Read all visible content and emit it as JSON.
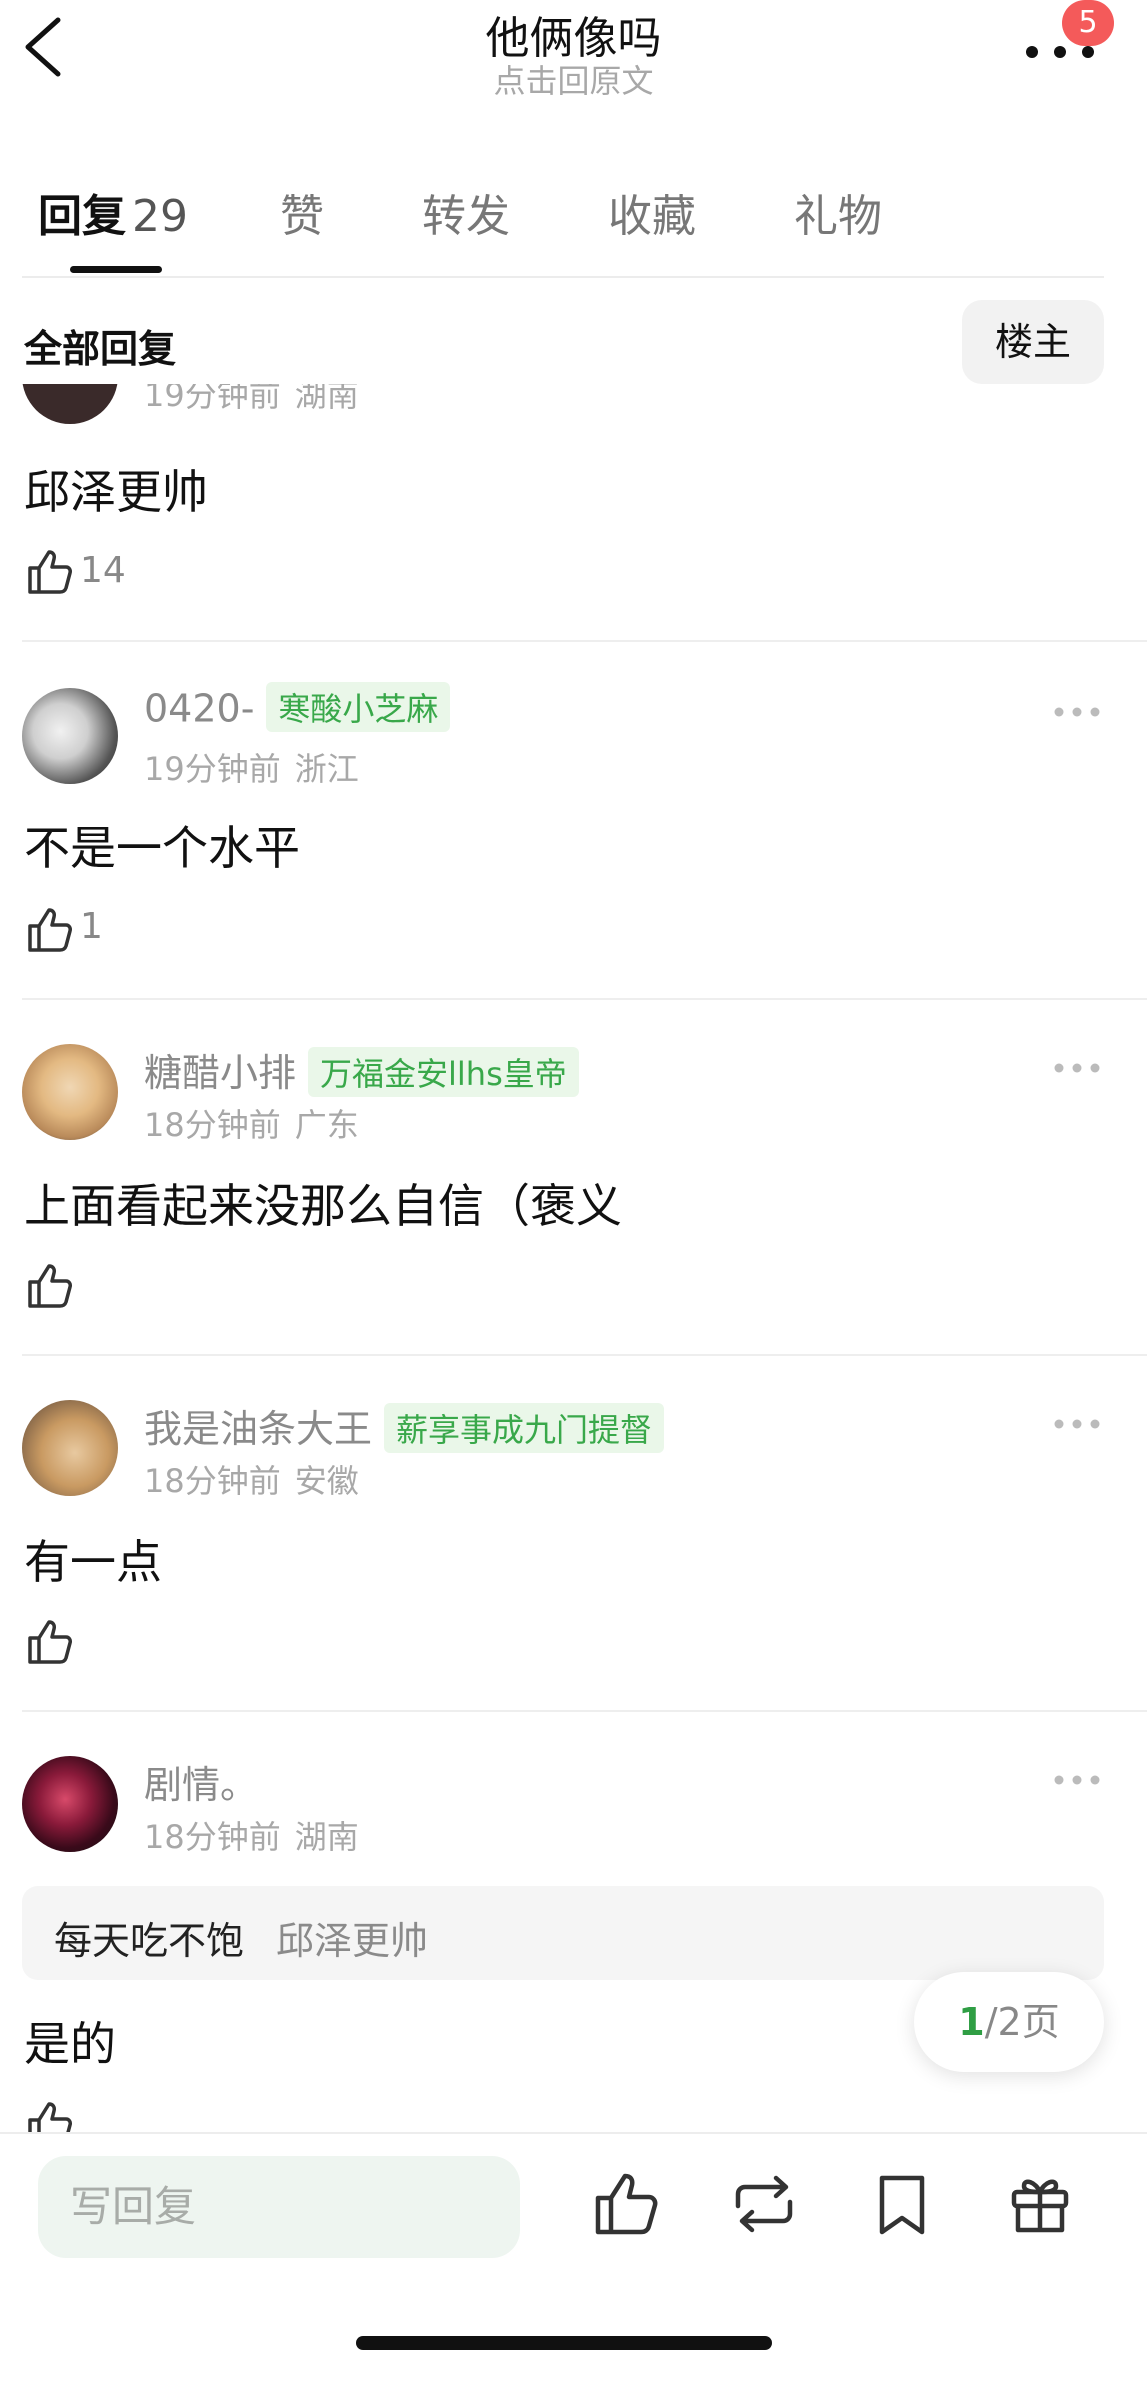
{
  "header": {
    "title": "他俩像吗",
    "subtitle": "点击回原文",
    "badge_count": "5",
    "back_icon": "chevron-left-icon",
    "more_icon": "more-horizontal-icon"
  },
  "tabs": [
    {
      "label": "回复",
      "count": "29",
      "active": true
    },
    {
      "label": "赞"
    },
    {
      "label": "转发"
    },
    {
      "label": "收藏"
    },
    {
      "label": "礼物"
    }
  ],
  "filter": {
    "title": "全部回复",
    "owner_button": "楼主"
  },
  "comments": [
    {
      "partial": true,
      "meta_time": "19分钟前",
      "meta_loc": "湖南",
      "text": "邱泽更帅",
      "likes": "14"
    },
    {
      "username": "0420-",
      "tag": "寒酸小芝麻",
      "meta_time": "19分钟前",
      "meta_loc": "浙江",
      "text": "不是一个水平",
      "likes": "1"
    },
    {
      "username": "糖醋小排",
      "tag": "万福金安llhs皇帝",
      "meta_time": "18分钟前",
      "meta_loc": "广东",
      "text": "上面看起来没那么自信（褒义",
      "likes": ""
    },
    {
      "username": "我是油条大王",
      "tag": "薪享事成九门提督",
      "meta_time": "18分钟前",
      "meta_loc": "安徽",
      "text": "有一点",
      "likes": ""
    },
    {
      "username": "剧情。",
      "tag": "",
      "meta_time": "18分钟前",
      "meta_loc": "湖南",
      "quote_user": "每天吃不饱",
      "quote_text": "邱泽更帅",
      "text": "是的",
      "likes": ""
    }
  ],
  "pagination": {
    "current": "1",
    "total_label": "/2页"
  },
  "bottom_bar": {
    "reply_placeholder": "写回复",
    "icons": [
      "thumbs-up-icon",
      "repost-icon",
      "bookmark-icon",
      "gift-icon"
    ]
  },
  "colors": {
    "tag_bg": "#eaf7e9",
    "tag_text": "#39a84a",
    "badge": "#f45a5a",
    "page_current": "#2f9e44"
  }
}
